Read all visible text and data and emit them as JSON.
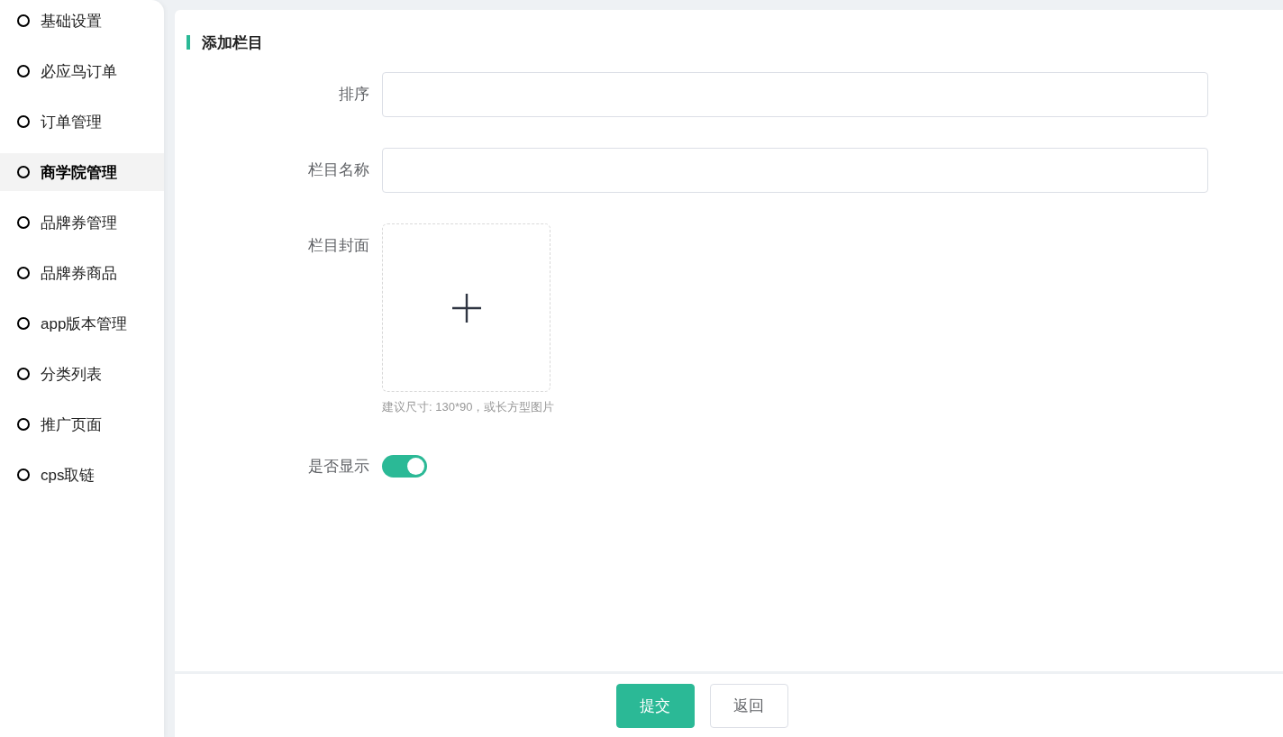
{
  "sidebar": {
    "items": [
      {
        "label": "基础设置",
        "selected": false
      },
      {
        "label": "必应鸟订单",
        "selected": false
      },
      {
        "label": "订单管理",
        "selected": false
      },
      {
        "label": "商学院管理",
        "selected": true
      },
      {
        "label": "品牌券管理",
        "selected": false
      },
      {
        "label": "品牌券商品",
        "selected": false
      },
      {
        "label": "app版本管理",
        "selected": false
      },
      {
        "label": "分类列表",
        "selected": false
      },
      {
        "label": "推广页面",
        "selected": false
      },
      {
        "label": "cps取链",
        "selected": false
      }
    ]
  },
  "form": {
    "title": "添加栏目",
    "fields": [
      {
        "kind": "input",
        "label": "排序"
      },
      {
        "kind": "input",
        "label": "栏目名称"
      },
      {
        "kind": "upload",
        "label": "栏目封面",
        "hint": "建议尺寸: 130*90，或长方型图片"
      },
      {
        "kind": "switch",
        "label": "是否显示",
        "on": true
      }
    ]
  },
  "footer": {
    "buttons": [
      {
        "label": "提交",
        "kind": "primary"
      },
      {
        "label": "返回",
        "kind": "default"
      }
    ]
  }
}
